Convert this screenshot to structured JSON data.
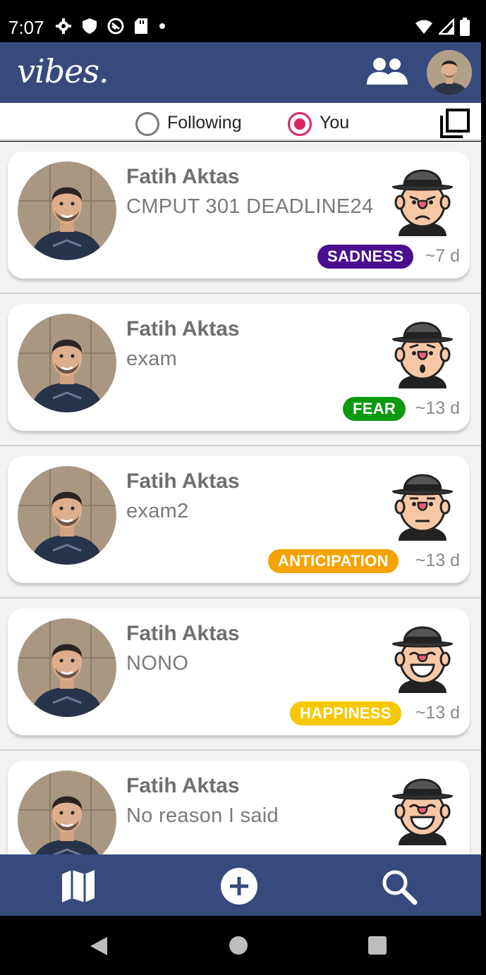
{
  "status_bar": {
    "time": "7:07",
    "left_icons": [
      "settings-icon",
      "shield-icon",
      "sync-icon",
      "sd-card-icon",
      "dot-icon"
    ],
    "right_icons": [
      "wifi-icon",
      "signal-icon",
      "battery-icon"
    ]
  },
  "app_bar": {
    "logo": "vibes.",
    "bg_color": "#364a7e",
    "icons": [
      "people-icon",
      "profile-avatar"
    ]
  },
  "filter": {
    "options": [
      {
        "label": "Following",
        "selected": false
      },
      {
        "label": "You",
        "selected": true
      }
    ],
    "accent": "#e0245e"
  },
  "feed": {
    "items": [
      {
        "name": "Fatih Aktas",
        "text": "CMPUT 301 DEADLINE24",
        "emotion": "SADNESS",
        "emotion_color": "#4a0f8f",
        "time": "~7 d",
        "emoji": "sad-face-icon"
      },
      {
        "name": "Fatih Aktas",
        "text": "exam",
        "emotion": "FEAR",
        "emotion_color": "#0a9a0f",
        "time": "~13 d",
        "emoji": "fear-face-icon"
      },
      {
        "name": "Fatih Aktas",
        "text": "exam2",
        "emotion": "ANTICIPATION",
        "emotion_color": "#f5a300",
        "time": "~13 d",
        "emoji": "anticipation-face-icon"
      },
      {
        "name": "Fatih Aktas",
        "text": "NONO",
        "emotion": "HAPPINESS",
        "emotion_color": "#f7c800",
        "time": "~13 d",
        "emoji": "happy-face-icon"
      },
      {
        "name": "Fatih Aktas",
        "text": "No reason I said",
        "emotion": "",
        "emotion_color": "",
        "time": "",
        "emoji": "happy-face-icon"
      }
    ]
  },
  "bottom_nav": {
    "items": [
      "map-icon",
      "add-icon",
      "search-icon"
    ]
  },
  "system_nav": {
    "items": [
      "back-icon",
      "home-icon",
      "recents-icon"
    ]
  }
}
